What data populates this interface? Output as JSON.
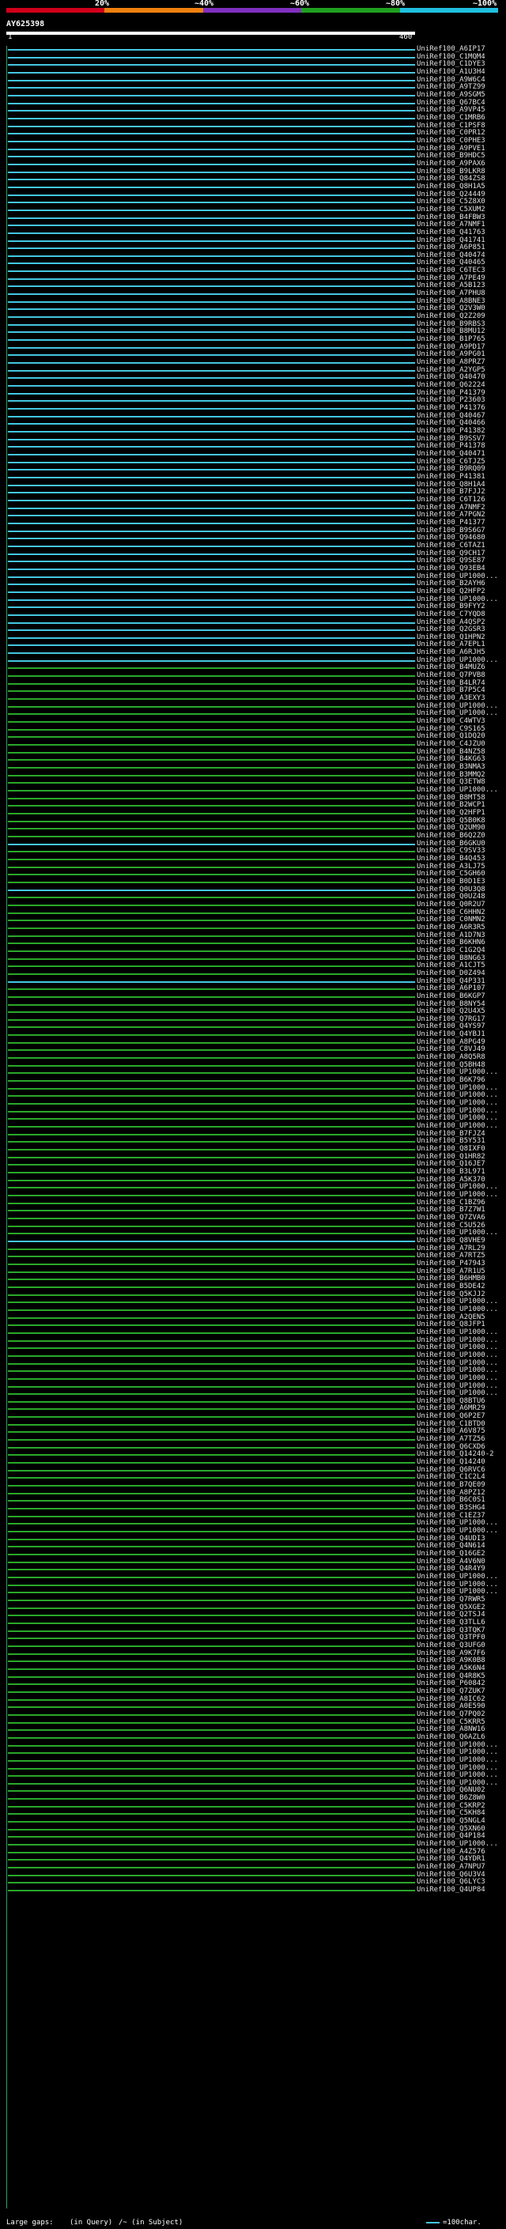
{
  "scale": {
    "labels": [
      "20%",
      "~40%",
      "~60%",
      "~80%",
      "~100%"
    ],
    "colors": [
      "#d0001a",
      "#f08010",
      "#8030c0",
      "#20a020",
      "#20c0e0"
    ]
  },
  "query": {
    "title": "AY625398",
    "start": "1",
    "end": "460"
  },
  "colors": {
    "high": "#44c6e0",
    "mid": "#2aa82a",
    "lowlight": "#c000c0",
    "gap": "#ffffff"
  },
  "hits": [
    {
      "label": "UniRef100_A6IP17",
      "tier": "high"
    },
    {
      "label": "UniRef100_C1MQM4",
      "tier": "high"
    },
    {
      "label": "UniRef100_C1DYE3",
      "tier": "high"
    },
    {
      "label": "UniRef100_A1U3H4",
      "tier": "high"
    },
    {
      "label": "UniRef100_A9W6C4",
      "tier": "high"
    },
    {
      "label": "UniRef100_A9TZ99",
      "tier": "high"
    },
    {
      "label": "UniRef100_A9SGM5",
      "tier": "high"
    },
    {
      "label": "UniRef100_Q67BC4",
      "tier": "high"
    },
    {
      "label": "UniRef100_A9VP45",
      "tier": "high"
    },
    {
      "label": "UniRef100_C1MRB6",
      "tier": "high"
    },
    {
      "label": "UniRef100_C1PSF8",
      "tier": "high"
    },
    {
      "label": "UniRef100_C0PR12",
      "tier": "high"
    },
    {
      "label": "UniRef100_C0PHE3",
      "tier": "high"
    },
    {
      "label": "UniRef100_A9PVE1",
      "tier": "high"
    },
    {
      "label": "UniRef100_B9HDC5",
      "tier": "high"
    },
    {
      "label": "UniRef100_A9PAX6",
      "tier": "high"
    },
    {
      "label": "UniRef100_B9LKR8",
      "tier": "high"
    },
    {
      "label": "UniRef100_Q84ZS8",
      "tier": "high"
    },
    {
      "label": "UniRef100_Q8H1A5",
      "tier": "high"
    },
    {
      "label": "UniRef100_Q24449",
      "tier": "high"
    },
    {
      "label": "UniRef100_C5Z8X0",
      "tier": "high"
    },
    {
      "label": "UniRef100_C5XUM2",
      "tier": "high"
    },
    {
      "label": "UniRef100_B4FBW3",
      "tier": "high"
    },
    {
      "label": "UniRef100_A7NMF1",
      "tier": "high"
    },
    {
      "label": "UniRef100_Q41763",
      "tier": "high"
    },
    {
      "label": "UniRef100_Q41741",
      "tier": "high"
    },
    {
      "label": "UniRef100_A6P851",
      "tier": "high"
    },
    {
      "label": "UniRef100_Q40474",
      "tier": "high"
    },
    {
      "label": "UniRef100_Q40465",
      "tier": "high"
    },
    {
      "label": "UniRef100_C6TEC3",
      "tier": "high"
    },
    {
      "label": "UniRef100_A7PE49",
      "tier": "high"
    },
    {
      "label": "UniRef100_A5B123",
      "tier": "high"
    },
    {
      "label": "UniRef100_A7PHU8",
      "tier": "high"
    },
    {
      "label": "UniRef100_A8BNE3",
      "tier": "high"
    },
    {
      "label": "UniRef100_Q2V3W0",
      "tier": "high"
    },
    {
      "label": "UniRef100_Q2Z209",
      "tier": "high"
    },
    {
      "label": "UniRef100_B9RBS3",
      "tier": "high"
    },
    {
      "label": "UniRef100_B8MU12",
      "tier": "high"
    },
    {
      "label": "UniRef100_B1P765",
      "tier": "high"
    },
    {
      "label": "UniRef100_A9PD17",
      "tier": "high"
    },
    {
      "label": "UniRef100_A9PG01",
      "tier": "high"
    },
    {
      "label": "UniRef100_A8PRZ7",
      "tier": "high"
    },
    {
      "label": "UniRef100_A2YGP5",
      "tier": "high"
    },
    {
      "label": "UniRef100_Q40470",
      "tier": "high"
    },
    {
      "label": "UniRef100_Q62224",
      "tier": "high"
    },
    {
      "label": "UniRef100_P41379",
      "tier": "high"
    },
    {
      "label": "UniRef100_P23603",
      "tier": "high"
    },
    {
      "label": "UniRef100_P41376",
      "tier": "high"
    },
    {
      "label": "UniRef100_Q40467",
      "tier": "high"
    },
    {
      "label": "UniRef100_Q40466",
      "tier": "high"
    },
    {
      "label": "UniRef100_P41382",
      "tier": "high"
    },
    {
      "label": "UniRef100_B9SSV7",
      "tier": "high"
    },
    {
      "label": "UniRef100_P41378",
      "tier": "high"
    },
    {
      "label": "UniRef100_Q40471",
      "tier": "high"
    },
    {
      "label": "UniRef100_C6TJZ5",
      "tier": "high"
    },
    {
      "label": "UniRef100_B9RQ09",
      "tier": "high"
    },
    {
      "label": "UniRef100_P41381",
      "tier": "high"
    },
    {
      "label": "UniRef100_Q8H1A4",
      "tier": "high"
    },
    {
      "label": "UniRef100_B7FJJ2",
      "tier": "high"
    },
    {
      "label": "UniRef100_C6T126",
      "tier": "high"
    },
    {
      "label": "UniRef100_A7NMF2",
      "tier": "high"
    },
    {
      "label": "UniRef100_A7PGN2",
      "tier": "high"
    },
    {
      "label": "UniRef100_P41377",
      "tier": "high"
    },
    {
      "label": "UniRef100_B9S6G7",
      "tier": "high"
    },
    {
      "label": "UniRef100_Q94680",
      "tier": "high"
    },
    {
      "label": "UniRef100_C6TAZ1",
      "tier": "high"
    },
    {
      "label": "UniRef100_Q9CH17",
      "tier": "high"
    },
    {
      "label": "UniRef100_Q9SE87",
      "tier": "high"
    },
    {
      "label": "UniRef100_Q93EB4",
      "tier": "high"
    },
    {
      "label": "UniRef100_UP1000...",
      "tier": "high"
    },
    {
      "label": "UniRef100_B2AYH6",
      "tier": "high"
    },
    {
      "label": "UniRef100_Q2HFP2",
      "tier": "high"
    },
    {
      "label": "UniRef100_UP1000...",
      "tier": "high"
    },
    {
      "label": "UniRef100_B9FYY2",
      "tier": "high"
    },
    {
      "label": "UniRef100_C7YQD8",
      "tier": "high"
    },
    {
      "label": "UniRef100_A4QSP2",
      "tier": "high"
    },
    {
      "label": "UniRef100_Q2GSR3",
      "tier": "high"
    },
    {
      "label": "UniRef100_Q1HPN2",
      "tier": "high"
    },
    {
      "label": "UniRef100_A7EPL1",
      "tier": "high"
    },
    {
      "label": "UniRef100_A6RJH5",
      "tier": "high"
    },
    {
      "label": "UniRef100_UP1000...",
      "tier": "high"
    },
    {
      "label": "UniRef100_B4MUZ6",
      "tier": "mid"
    },
    {
      "label": "UniRef100_Q7PVB8",
      "tier": "mid"
    },
    {
      "label": "UniRef100_B4LR74",
      "tier": "mid"
    },
    {
      "label": "UniRef100_B7P5C4",
      "tier": "mid"
    },
    {
      "label": "UniRef100_A3EXY3",
      "tier": "mid"
    },
    {
      "label": "UniRef100_UP1000...",
      "tier": "mid"
    },
    {
      "label": "UniRef100_UP1000...",
      "tier": "mid"
    },
    {
      "label": "UniRef100_C4WTV3",
      "tier": "mid"
    },
    {
      "label": "UniRef100_C9S165",
      "tier": "mid"
    },
    {
      "label": "UniRef100_Q1DQ20",
      "tier": "mid"
    },
    {
      "label": "UniRef100_C4JZU0",
      "tier": "mid"
    },
    {
      "label": "UniRef100_B4NZ58",
      "tier": "mid"
    },
    {
      "label": "UniRef100_B4KG63",
      "tier": "mid"
    },
    {
      "label": "UniRef100_B3NMA3",
      "tier": "mid"
    },
    {
      "label": "UniRef100_B3MMQ2",
      "tier": "mid"
    },
    {
      "label": "UniRef100_Q3ETW8",
      "tier": "mid"
    },
    {
      "label": "UniRef100_UP1000...",
      "tier": "mid"
    },
    {
      "label": "UniRef100_B8MT58",
      "tier": "mid"
    },
    {
      "label": "UniRef100_B2WCP1",
      "tier": "mid"
    },
    {
      "label": "UniRef100_Q2HFP1",
      "tier": "mid"
    },
    {
      "label": "UniRef100_Q5B0K8",
      "tier": "mid"
    },
    {
      "label": "UniRef100_Q2UM90",
      "tier": "mid"
    },
    {
      "label": "UniRef100_B6Q2Z0",
      "tier": "mid"
    },
    {
      "label": "UniRef100_B6GKU0",
      "tier": "high"
    },
    {
      "label": "UniRef100_C9SV33",
      "tier": "mid"
    },
    {
      "label": "UniRef100_B4Q453",
      "tier": "mid"
    },
    {
      "label": "UniRef100_A3LJ75",
      "tier": "mid"
    },
    {
      "label": "UniRef100_C5GH60",
      "tier": "mid"
    },
    {
      "label": "UniRef100_B0D1E3",
      "tier": "mid"
    },
    {
      "label": "UniRef100_Q0U3Q8",
      "tier": "high"
    },
    {
      "label": "UniRef100_Q0UZ48",
      "tier": "mid"
    },
    {
      "label": "UniRef100_Q0R2U7",
      "tier": "mid"
    },
    {
      "label": "UniRef100_C6HHN2",
      "tier": "mid"
    },
    {
      "label": "UniRef100_C0NMN2",
      "tier": "mid"
    },
    {
      "label": "UniRef100_A6R3R5",
      "tier": "mid"
    },
    {
      "label": "UniRef100_A1D7N3",
      "tier": "mid"
    },
    {
      "label": "UniRef100_B6KHN6",
      "tier": "mid"
    },
    {
      "label": "UniRef100_C1G2Q4",
      "tier": "mid"
    },
    {
      "label": "UniRef100_B8NG63",
      "tier": "mid"
    },
    {
      "label": "UniRef100_A1CJT5",
      "tier": "mid"
    },
    {
      "label": "UniRef100_D0Z494",
      "tier": "mid"
    },
    {
      "label": "UniRef100_Q4P331",
      "tier": "high"
    },
    {
      "label": "UniRef100_A6P107",
      "tier": "mid"
    },
    {
      "label": "UniRef100_B6KGP7",
      "tier": "mid"
    },
    {
      "label": "UniRef100_B8NY54",
      "tier": "mid"
    },
    {
      "label": "UniRef100_Q2U4X5",
      "tier": "mid"
    },
    {
      "label": "UniRef100_Q7RG17",
      "tier": "mid"
    },
    {
      "label": "UniRef100_Q4YS97",
      "tier": "mid"
    },
    {
      "label": "UniRef100_Q4YBJ1",
      "tier": "mid"
    },
    {
      "label": "UniRef100_A8PG49",
      "tier": "mid"
    },
    {
      "label": "UniRef100_C8VJ49",
      "tier": "mid"
    },
    {
      "label": "UniRef100_A8Q5R8",
      "tier": "mid"
    },
    {
      "label": "UniRef100_Q5BH48",
      "tier": "mid"
    },
    {
      "label": "UniRef100_UP1000...",
      "tier": "mid"
    },
    {
      "label": "UniRef100_B6K796",
      "tier": "mid"
    },
    {
      "label": "UniRef100_UP1000...",
      "tier": "mid"
    },
    {
      "label": "UniRef100_UP1000...",
      "tier": "mid"
    },
    {
      "label": "UniRef100_UP1000...",
      "tier": "mid"
    },
    {
      "label": "UniRef100_UP1000...",
      "tier": "mid"
    },
    {
      "label": "UniRef100_UP1000...",
      "tier": "mid"
    },
    {
      "label": "UniRef100_UP1000...",
      "tier": "mid"
    },
    {
      "label": "UniRef100_B7FJZ4",
      "tier": "mid"
    },
    {
      "label": "UniRef100_B5Y531",
      "tier": "mid"
    },
    {
      "label": "UniRef100_Q8IXF0",
      "tier": "mid"
    },
    {
      "label": "UniRef100_Q1HR82",
      "tier": "mid"
    },
    {
      "label": "UniRef100_Q16JE7",
      "tier": "mid"
    },
    {
      "label": "UniRef100_B3L971",
      "tier": "mid"
    },
    {
      "label": "UniRef100_A5K370",
      "tier": "mid"
    },
    {
      "label": "UniRef100_UP1000...",
      "tier": "mid"
    },
    {
      "label": "UniRef100_UP1000...",
      "tier": "mid"
    },
    {
      "label": "UniRef100_C1BZ96",
      "tier": "mid"
    },
    {
      "label": "UniRef100_B7Z7W1",
      "tier": "mid"
    },
    {
      "label": "UniRef100_Q7ZVA6",
      "tier": "mid"
    },
    {
      "label": "UniRef100_C5U526",
      "tier": "mid"
    },
    {
      "label": "UniRef100_UP1000...",
      "tier": "mid"
    },
    {
      "label": "UniRef100_Q8VHE9",
      "tier": "high"
    },
    {
      "label": "UniRef100_A7RL29",
      "tier": "mid"
    },
    {
      "label": "UniRef100_A7RTZ5",
      "tier": "mid"
    },
    {
      "label": "UniRef100_P47943",
      "tier": "mid"
    },
    {
      "label": "UniRef100_A7R1U5",
      "tier": "mid"
    },
    {
      "label": "UniRef100_B6HMB0",
      "tier": "mid"
    },
    {
      "label": "UniRef100_B5DE42",
      "tier": "mid"
    },
    {
      "label": "UniRef100_Q5KJJ2",
      "tier": "mid"
    },
    {
      "label": "UniRef100_UP1000...",
      "tier": "mid"
    },
    {
      "label": "UniRef100_UP1000...",
      "tier": "mid"
    },
    {
      "label": "UniRef100_A2QEN5",
      "tier": "mid"
    },
    {
      "label": "UniRef100_Q8JFP1",
      "tier": "mid"
    },
    {
      "label": "UniRef100_UP1000...",
      "tier": "mid"
    },
    {
      "label": "UniRef100_UP1000...",
      "tier": "mid"
    },
    {
      "label": "UniRef100_UP1000...",
      "tier": "mid"
    },
    {
      "label": "UniRef100_UP1000...",
      "tier": "mid"
    },
    {
      "label": "UniRef100_UP1000...",
      "tier": "mid"
    },
    {
      "label": "UniRef100_UP1000...",
      "tier": "mid"
    },
    {
      "label": "UniRef100_UP1000...",
      "tier": "mid"
    },
    {
      "label": "UniRef100_UP1000...",
      "tier": "mid"
    },
    {
      "label": "UniRef100_UP1000...",
      "tier": "mid"
    },
    {
      "label": "UniRef100_Q8BTU6",
      "tier": "mid"
    },
    {
      "label": "UniRef100_A6MR29",
      "tier": "mid"
    },
    {
      "label": "UniRef100_Q6P2E7",
      "tier": "mid"
    },
    {
      "label": "UniRef100_C1BTD0",
      "tier": "mid"
    },
    {
      "label": "UniRef100_A6V875",
      "tier": "mid"
    },
    {
      "label": "UniRef100_A7TZ56",
      "tier": "mid"
    },
    {
      "label": "UniRef100_Q6CXD6",
      "tier": "mid"
    },
    {
      "label": "UniRef100_Q14240-2",
      "tier": "mid"
    },
    {
      "label": "UniRef100_Q14240",
      "tier": "mid"
    },
    {
      "label": "UniRef100_Q6RVC6",
      "tier": "mid"
    },
    {
      "label": "UniRef100_C1C2L4",
      "tier": "mid"
    },
    {
      "label": "UniRef100_B7QE09",
      "tier": "mid"
    },
    {
      "label": "UniRef100_A8PZ12",
      "tier": "mid"
    },
    {
      "label": "UniRef100_B6C0S1",
      "tier": "mid"
    },
    {
      "label": "UniRef100_B3SHG4",
      "tier": "mid"
    },
    {
      "label": "UniRef100_C1EZ37",
      "tier": "mid"
    },
    {
      "label": "UniRef100_UP1000...",
      "tier": "mid"
    },
    {
      "label": "UniRef100_UP1000...",
      "tier": "mid"
    },
    {
      "label": "UniRef100_Q4UDI3",
      "tier": "mid"
    },
    {
      "label": "UniRef100_Q4N614",
      "tier": "mid"
    },
    {
      "label": "UniRef100_Q16GE2",
      "tier": "mid"
    },
    {
      "label": "UniRef100_A4V6N0",
      "tier": "mid"
    },
    {
      "label": "UniRef100_Q4R4Y9",
      "tier": "mid"
    },
    {
      "label": "UniRef100_UP1000...",
      "tier": "mid"
    },
    {
      "label": "UniRef100_UP1000...",
      "tier": "mid"
    },
    {
      "label": "UniRef100_UP1000...",
      "tier": "mid"
    },
    {
      "label": "UniRef100_Q7RWR5",
      "tier": "mid"
    },
    {
      "label": "UniRef100_Q5XGE2",
      "tier": "mid"
    },
    {
      "label": "UniRef100_Q2TSJ4",
      "tier": "mid"
    },
    {
      "label": "UniRef100_Q3TLL6",
      "tier": "mid"
    },
    {
      "label": "UniRef100_Q3TQK7",
      "tier": "mid"
    },
    {
      "label": "UniRef100_Q3TPF0",
      "tier": "mid"
    },
    {
      "label": "UniRef100_Q3UFG0",
      "tier": "mid"
    },
    {
      "label": "UniRef100_A9K7F6",
      "tier": "mid"
    },
    {
      "label": "UniRef100_A9K0B8",
      "tier": "mid"
    },
    {
      "label": "UniRef100_A5K6N4",
      "tier": "mid"
    },
    {
      "label": "UniRef100_Q4R8K5",
      "tier": "mid"
    },
    {
      "label": "UniRef100_P60842",
      "tier": "mid"
    },
    {
      "label": "UniRef100_Q7ZUK7",
      "tier": "mid"
    },
    {
      "label": "UniRef100_A8IC62",
      "tier": "mid"
    },
    {
      "label": "UniRef100_A0E590",
      "tier": "mid"
    },
    {
      "label": "UniRef100_Q7PQ02",
      "tier": "mid"
    },
    {
      "label": "UniRef100_C5KRR5",
      "tier": "mid"
    },
    {
      "label": "UniRef100_A8NW16",
      "tier": "mid"
    },
    {
      "label": "UniRef100_Q6AZL6",
      "tier": "mid"
    },
    {
      "label": "UniRef100_UP1000...",
      "tier": "mid"
    },
    {
      "label": "UniRef100_UP1000...",
      "tier": "mid"
    },
    {
      "label": "UniRef100_UP1000...",
      "tier": "mid"
    },
    {
      "label": "UniRef100_UP1000...",
      "tier": "mid"
    },
    {
      "label": "UniRef100_UP1000...",
      "tier": "mid"
    },
    {
      "label": "UniRef100_UP1000...",
      "tier": "mid"
    },
    {
      "label": "UniRef100_Q6NU02",
      "tier": "mid"
    },
    {
      "label": "UniRef100_B6Z8W0",
      "tier": "mid"
    },
    {
      "label": "UniRef100_C5KRP2",
      "tier": "mid"
    },
    {
      "label": "UniRef100_C5KH84",
      "tier": "mid"
    },
    {
      "label": "UniRef100_Q5NGL4",
      "tier": "mid"
    },
    {
      "label": "UniRef100_Q5XN60",
      "tier": "mid"
    },
    {
      "label": "UniRef100_Q4P184",
      "tier": "mid"
    },
    {
      "label": "UniRef100_UP1000...",
      "tier": "mid"
    },
    {
      "label": "UniRef100_A4Z576",
      "tier": "mid"
    },
    {
      "label": "UniRef100_Q4YDR1",
      "tier": "mid"
    },
    {
      "label": "UniRef100_A7NPU7",
      "tier": "mid"
    },
    {
      "label": "UniRef100_Q6U3V4",
      "tier": "mid"
    },
    {
      "label": "UniRef100_Q6LYC3",
      "tier": "mid"
    },
    {
      "label": "UniRef100_Q4UP84",
      "tier": "mid"
    }
  ],
  "legend": {
    "gaps_label": "Large gaps:",
    "in_query": "(in Query)",
    "in_subject": "/~ (in Subject)",
    "scale_label": "=100char."
  }
}
